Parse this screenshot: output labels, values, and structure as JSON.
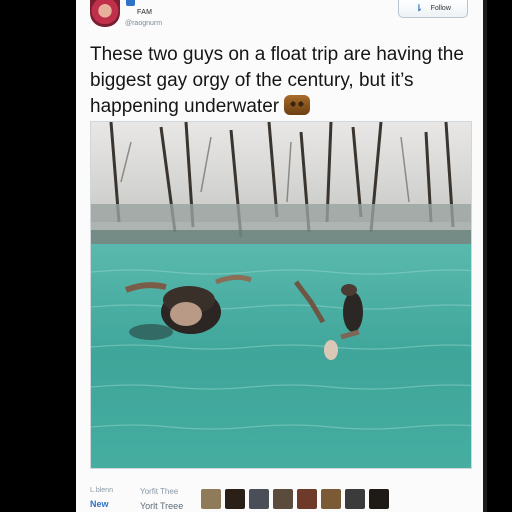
{
  "tweet": {
    "author_name": "FAM",
    "author_handle": "@raognurm",
    "follow_label": "Follow",
    "text": "These two guys on a float trip are having the biggest gay orgy of the century, but it’s happening underwater",
    "emoji_icon": "face-emoji-icon"
  },
  "stats": {
    "retweets_label": "L.blenn",
    "retweets_value": "New",
    "likes_label": "Yorfit Thee",
    "likes_value": "Yorlt Treee"
  },
  "likers": [
    {
      "color": "#8f7b5a"
    },
    {
      "color": "#2a2018"
    },
    {
      "color": "#4a4e57"
    },
    {
      "color": "#5b4b3c"
    },
    {
      "color": "#6e3a2a"
    },
    {
      "color": "#7a5b36"
    },
    {
      "color": "#3b3b3b"
    },
    {
      "color": "#1e1a16"
    }
  ],
  "colors": {
    "accent": "#2f73c8",
    "water": "#3fa59a",
    "background": "#000000"
  }
}
